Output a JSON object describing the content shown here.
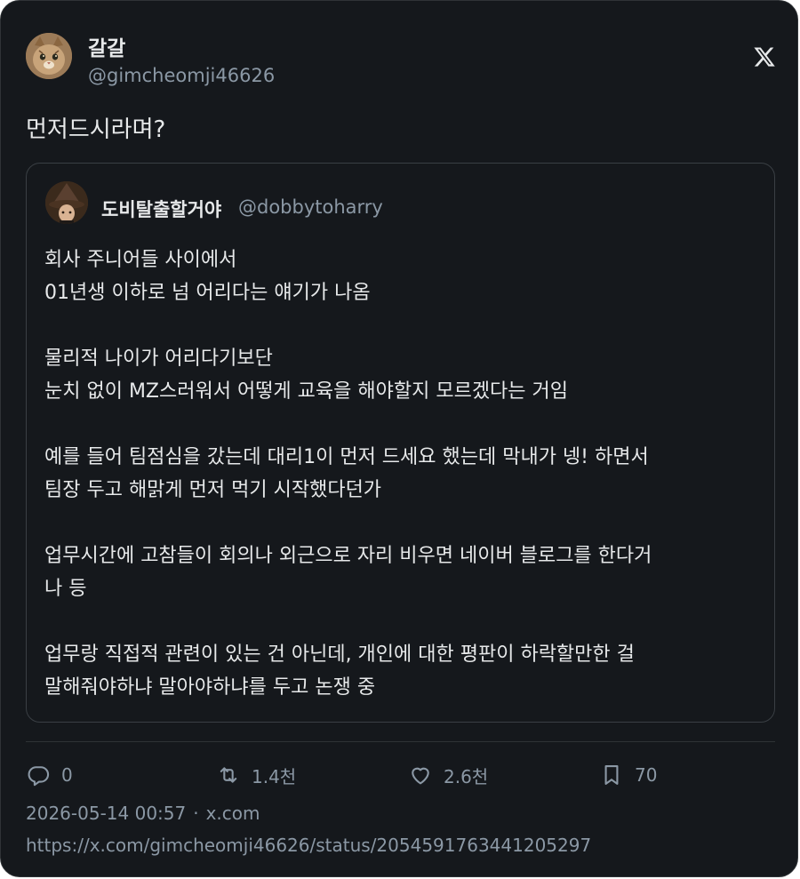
{
  "author": {
    "display_name": "갈갈",
    "handle": "@gimcheomji46626",
    "avatar": "cat-avatar"
  },
  "tweet": {
    "text": "먼저드시라며?"
  },
  "quoted": {
    "display_name": "도비탈출할거야",
    "handle": "@dobbytoharry",
    "avatar": "wizard-hat-avatar",
    "lines": [
      "회사 주니어들 사이에서",
      "01년생 이하로 넘 어리다는 얘기가 나옴",
      "",
      "물리적 나이가 어리다기보단",
      "눈치 없이 MZ스러워서 어떻게 교육을 해야할지 모르겠다는 거임",
      "",
      "예를 들어 팀점심을 갔는데 대리1이 먼저 드세요 했는데 막내가 넹! 하면서",
      "팀장 두고 해맑게 먼저 먹기 시작했다던가",
      "",
      "업무시간에 고참들이 회의나 외근으로 자리 비우면 네이버 블로그를 한다거",
      "나 등",
      "",
      "업무랑 직접적 관련이 있는 건 아닌데, 개인에 대한 평판이 하락할만한 걸",
      "말해줘야하냐 말아야하냐를 두고 논쟁 중"
    ]
  },
  "actions": {
    "reply": {
      "icon": "reply-icon",
      "count": "0"
    },
    "retweet": {
      "icon": "retweet-icon",
      "count": "1.4천"
    },
    "like": {
      "icon": "heart-icon",
      "count": "2.6천"
    },
    "bookmark": {
      "icon": "bookmark-icon",
      "count": "70"
    }
  },
  "meta": {
    "timestamp": "2026-05-14 00:57",
    "separator": "·",
    "source": "x.com",
    "url": "https://x.com/gimcheomji46626/status/2054591763441205297"
  },
  "colors": {
    "background": "#15181c",
    "text": "#e7e9ea",
    "secondary": "#8b98a5",
    "border": "#2f3336"
  }
}
